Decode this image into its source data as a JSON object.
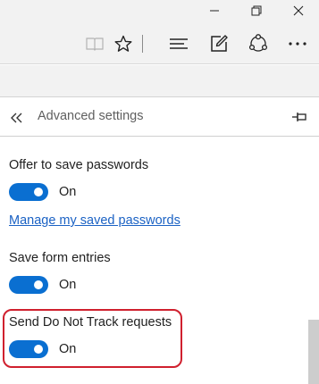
{
  "panel": {
    "title": "Advanced settings"
  },
  "settings": {
    "offer_passwords": {
      "label": "Offer to save passwords",
      "state": "On"
    },
    "manage_passwords_link": "Manage my saved passwords",
    "save_form_entries": {
      "label": "Save form entries",
      "state": "On"
    },
    "do_not_track": {
      "label": "Send Do Not Track requests",
      "state": "On"
    }
  },
  "colors": {
    "toggle_on": "#0a6fd1",
    "link": "#1b62c4",
    "highlight": "#d0202e",
    "chrome": "#f2f2f2"
  },
  "icons": {
    "toolbar": [
      "reading-view-icon",
      "favorites-star-icon",
      "hub-icon",
      "web-note-icon",
      "share-icon",
      "more-icon"
    ],
    "window": [
      "minimize-icon",
      "maximize-icon",
      "close-icon"
    ],
    "panel": [
      "back-chevrons-icon",
      "pin-icon"
    ]
  }
}
